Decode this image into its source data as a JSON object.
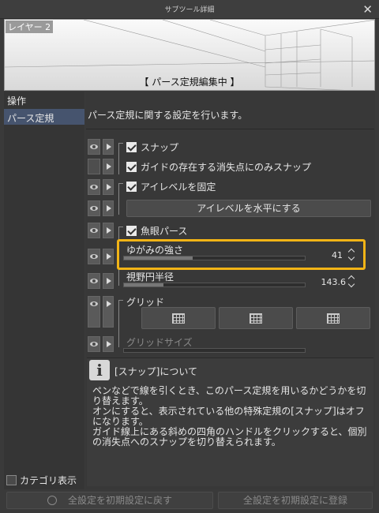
{
  "window": {
    "title": "サブツール詳細",
    "close_icon": "close-icon"
  },
  "preview": {
    "layer_name": "レイヤー 2",
    "status": "【 パース定規編集中 】"
  },
  "sidebar": {
    "items": [
      {
        "label": "操作",
        "selected": false
      },
      {
        "label": "パース定規",
        "selected": true
      }
    ],
    "category_show": {
      "label": "カテゴリ表示",
      "checked": false
    }
  },
  "main": {
    "description": "パース定規に関する設定を行います。",
    "snap": {
      "label": "スナップ",
      "checked": true
    },
    "guide_snap": {
      "label": "ガイドの存在する消失点にのみスナップ",
      "checked": true
    },
    "eye_level_fix": {
      "label": "アイレベルを固定",
      "checked": true
    },
    "eye_level_button": "アイレベルを水平にする",
    "fisheye": {
      "label": "魚眼パース",
      "checked": true
    },
    "distortion": {
      "label": "ゆがみの強さ",
      "value": "41",
      "fill": 0.38
    },
    "view_radius": {
      "label": "視野円半径",
      "value": "143.6",
      "fill": 0.22
    },
    "grid": {
      "label": "グリッド"
    },
    "grid_size": {
      "label": "グリッドサイズ"
    }
  },
  "info": {
    "icon": "info-icon",
    "title": "[スナップ]について",
    "lines": [
      "ペンなどで線を引くとき、このパース定規を用いるかどうかを切り替えます。",
      "オンにすると、表示されている他の特殊定規の[スナップ]はオフになります。",
      "ガイド線上にある斜めの四角のハンドルをクリックすると、個別の消失点へのスナップを切り替えられます。"
    ]
  },
  "footer": {
    "reset_label": "全設定を初期設定に戻す",
    "register_label": "全設定を初期設定に登録"
  },
  "colors": {
    "highlight": "#f2b416",
    "selected": "#46546e"
  }
}
